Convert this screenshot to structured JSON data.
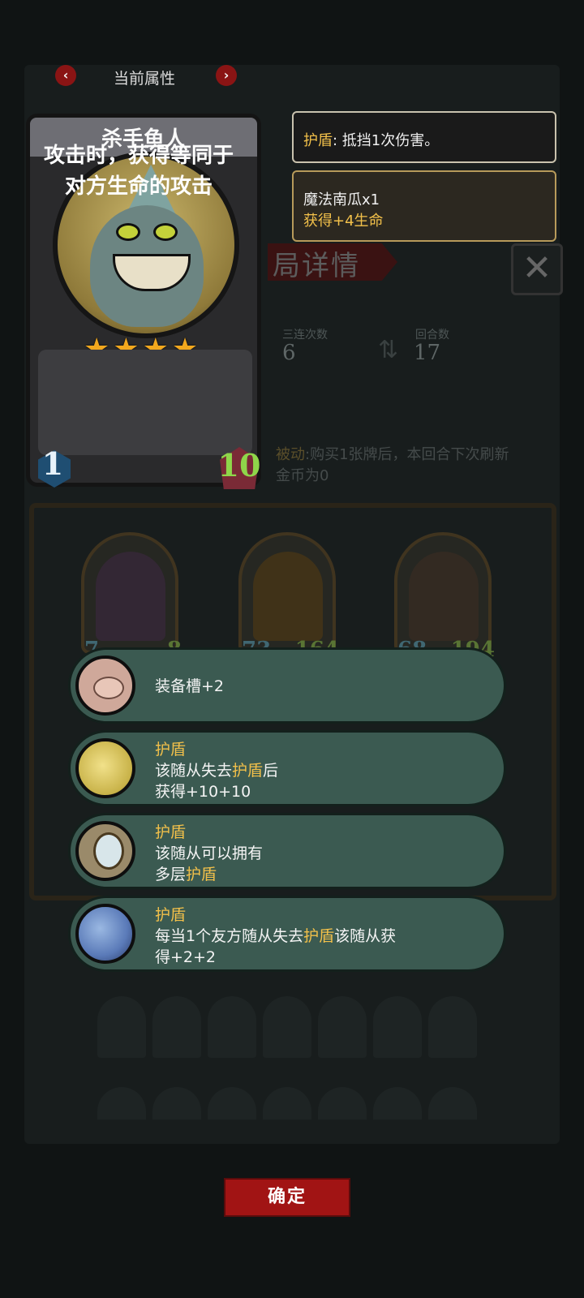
{
  "header": {
    "title": "当前属性",
    "prev_icon": "chevron-left-icon",
    "next_icon": "chevron-right-icon"
  },
  "card": {
    "name": "杀手鱼人",
    "stars": 4,
    "description": "攻击时，获得等同于对方生命的攻击",
    "tier": "1",
    "health": "10"
  },
  "tooltips": {
    "shield": {
      "keyword": "护盾",
      "text": ": 抵挡1次伤害。"
    },
    "item": {
      "name": "魔法南瓜x1",
      "effect": "获得+4生命"
    }
  },
  "effects": [
    {
      "icon": "pig-icon",
      "title": "",
      "lines": [
        "装备槽+2"
      ]
    },
    {
      "icon": "moon-icon",
      "title": "护盾",
      "lines": [
        "该随从失去",
        "护盾",
        "后",
        "获得+10+10"
      ]
    },
    {
      "icon": "mirror-icon",
      "title": "护盾",
      "lines": [
        "该随从可以拥有",
        "多层",
        "护盾"
      ]
    },
    {
      "icon": "planet-icon",
      "title": "护盾",
      "lines": [
        "每当1个友方随从失去",
        "护盾",
        "该随从获",
        "得+2+2"
      ]
    }
  ],
  "background": {
    "panel_title": "局详情",
    "stat1_label": "三连次数",
    "stat1_value": "6",
    "stat2_label": "回合数",
    "stat2_value": "17",
    "passive_label": "被动",
    "passive_text": ":购买1张牌后，本回合下次刷新",
    "passive_text2": "金币为0",
    "minions": [
      {
        "atk": "7",
        "hp": "8"
      },
      {
        "atk": "73",
        "hp": "164"
      },
      {
        "atk": "68",
        "hp": "194"
      }
    ]
  },
  "confirm_label": "确定",
  "colors": {
    "accent_red": "#a11414",
    "keyword_gold": "#f2c04a",
    "effect_row": "#3b5a51",
    "star": "#f2a81e",
    "health_green": "#8fd64a"
  }
}
